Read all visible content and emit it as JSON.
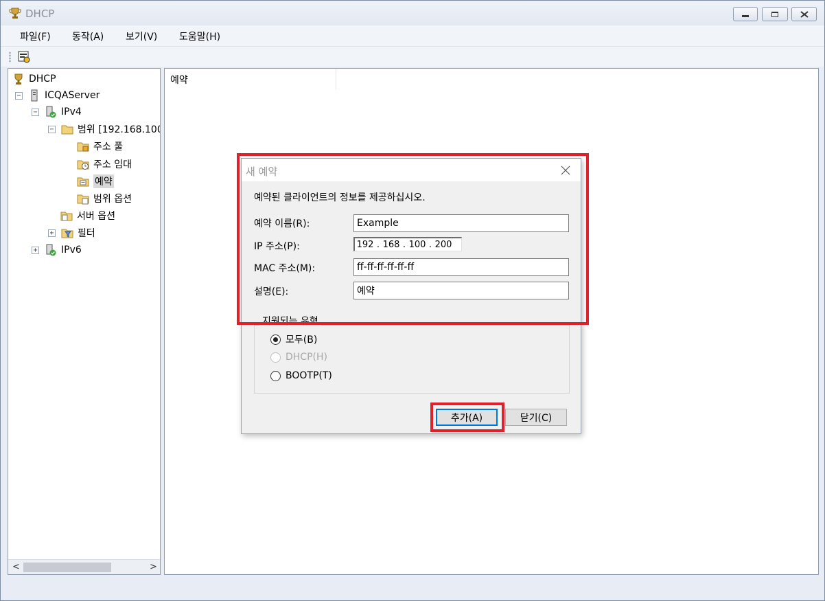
{
  "window": {
    "title": "DHCP"
  },
  "menu": [
    "파일(F)",
    "동작(A)",
    "보기(V)",
    "도움말(H)"
  ],
  "tree": {
    "root": "DHCP",
    "server": "ICQAServer",
    "ipv4": "IPv4",
    "scope": "범위 [192.168.100",
    "address_pool": "주소 풀",
    "address_leases": "주소 임대",
    "reservations": "예약",
    "scope_options": "범위 옵션",
    "server_options": "서버 옵션",
    "filters": "필터",
    "ipv6": "IPv6"
  },
  "content": {
    "column_header": "예약"
  },
  "dialog": {
    "title": "새 예약",
    "instruction": "예약된 클라이언트의 정보를 제공하십시오.",
    "name_label": "예약 이름(R):",
    "name_value": "Example",
    "ip_label": "IP 주소(P):",
    "ip_octets": [
      "192",
      "168",
      "100",
      "200"
    ],
    "mac_label": "MAC 주소(M):",
    "mac_value": "ff-ff-ff-ff-ff-ff",
    "desc_label": "설명(E):",
    "desc_value": "예약",
    "group_title": "지원되는 유형",
    "radio_both": "모두(B)",
    "radio_dhcp": "DHCP(H)",
    "radio_bootp": "BOOTP(T)",
    "add_button": "추가(A)",
    "close_button": "닫기(C)"
  },
  "colors": {
    "highlight": "#e0202a"
  }
}
